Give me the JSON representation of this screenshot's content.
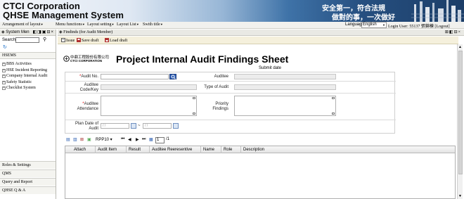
{
  "banner": {
    "title_line1": "CTCI Corporation",
    "title_line2": "QHSE Management System",
    "slogan_line1": "安全第一，符合法規",
    "slogan_line2": "做對的事，一次做好"
  },
  "menubar": {
    "items": [
      "Arrangement of layout",
      "Menu functions",
      "Layout setting",
      "Layout List",
      "Swith title"
    ],
    "language_label": "Language",
    "language_value": "English",
    "user_info": "Login User: 55137 張錦棟 [Logout]"
  },
  "left_panel": {
    "title": "System Men",
    "search_label": "Search:",
    "search_value": "",
    "section": "HSEMS",
    "tree": [
      "BBS Activities",
      "HSE Incident Reporting",
      "Company Internal Audit",
      "Safety Statistic",
      "Checklist System"
    ],
    "accordion": [
      "Roles & Settings",
      "QMS",
      "Query and Report",
      "QHSE Q & A"
    ]
  },
  "main": {
    "tab_title": "Findinds (for Audit Member)",
    "toolbar": {
      "issue_label": "Issue",
      "save_draft_label": "Save draft",
      "load_draft_label": "Load draft"
    },
    "logo_cn": "中鼎工程股份有限公司",
    "logo_en": "CTCI CORPORATION",
    "sheet_title": "Project Internal Audit Findings Sheet",
    "submit_date_label": "Submit date",
    "form": {
      "audit_no_label": "Audit No.",
      "auditee_label": "Auditee",
      "auditee_code_label": "Auditee Code/Key",
      "type_of_audit_label": "Type of Audit",
      "auditee_attendance_label": "Auditee Attendance",
      "priority_findings_label": "Priority Findings",
      "plan_date_label": "Plan Date of Audit",
      "date_placeholder": "/ /",
      "required_mark": "*",
      "date_separator": "~"
    },
    "grid": {
      "rpp_label": "RPP10",
      "page_value": "1",
      "page_total": "/1",
      "columns": [
        "Attach",
        "Audit Item",
        "Result",
        "Auditee Reeresentive",
        "Name",
        "Role",
        "Description"
      ]
    }
  },
  "colors": {
    "banner_dark": "#1c3e68",
    "toolbar_bg": "#f5f0dc",
    "required": "#dd0000",
    "search_button": "#2f5fb4"
  }
}
